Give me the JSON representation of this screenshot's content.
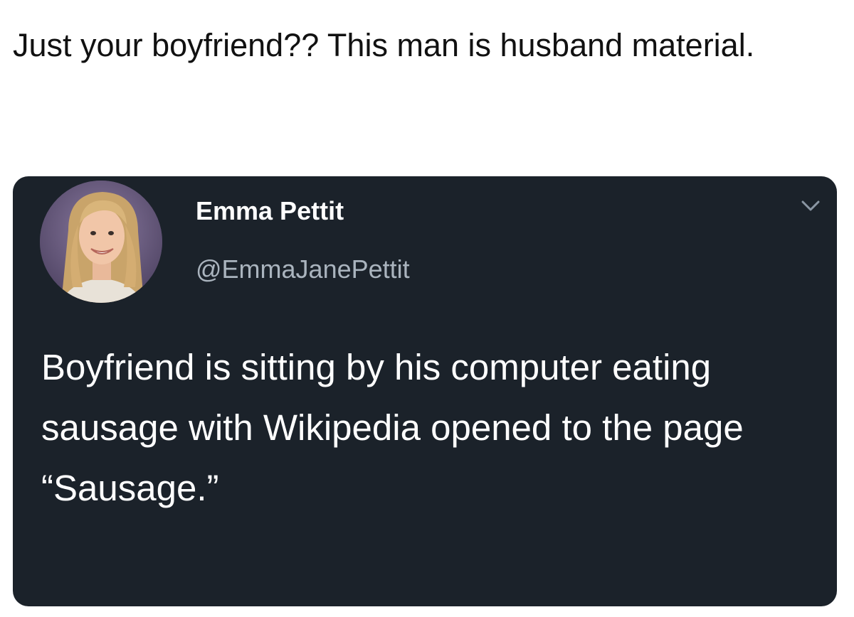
{
  "caption": {
    "text": "Just your boyfriend?? This man is husband material."
  },
  "tweet": {
    "author_name": "Emma Pettit",
    "author_handle": "@EmmaJanePettit",
    "text": "Boyfriend is sitting by his computer eating sausage with Wikipedia opened to the page “Sausage.”",
    "menu_icon": "chevron-down-icon",
    "avatar_icon": "profile-photo"
  },
  "colors": {
    "page_background": "#ffffff",
    "card_background": "#1b222a",
    "name_text": "#ffffff",
    "handle_text": "#aab4be",
    "body_text": "#ffffff"
  }
}
